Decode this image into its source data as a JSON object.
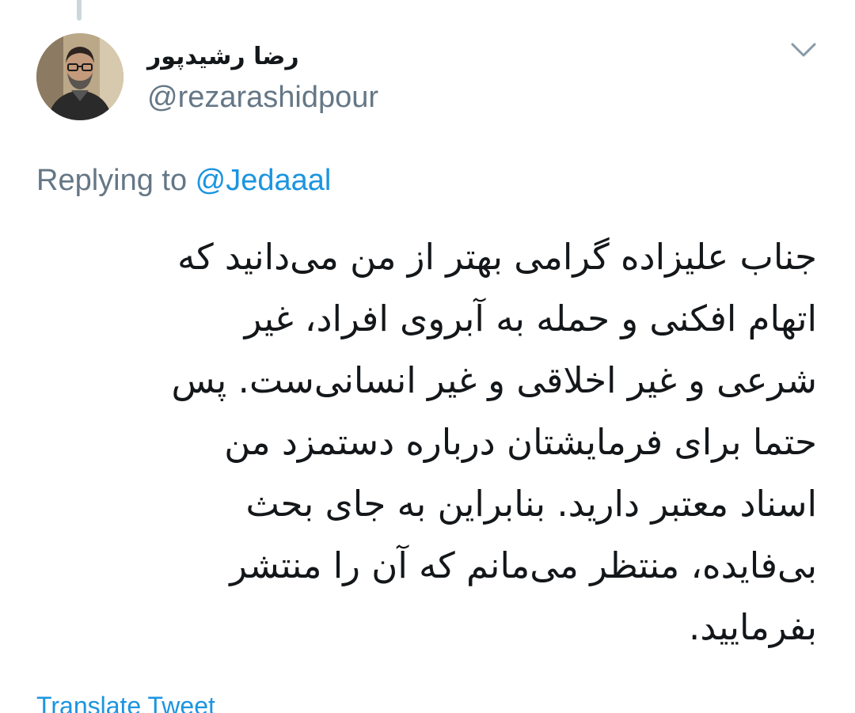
{
  "author": {
    "display_name": "رضا رشیدپور",
    "handle": "@rezarashidpour",
    "avatar_icon": "profile-photo"
  },
  "reply": {
    "prefix": "Replying to ",
    "mention": "@Jedaaal"
  },
  "tweet": {
    "lines": [
      "جناب علیزاده گرامی بهتر از من می‌دانید که",
      "اتهام افکنی و حمله به آبروی افراد، غیر",
      "شرعی و غیر اخلاقی و غیر انسانی‌ست. پس",
      "حتما برای فرمایشتان درباره دستمزد من",
      "اسناد معتبر دارید. بنابراین به جای بحث",
      "بی‌فایده، منتظر می‌مانم که آن را منتشر",
      "بفرمایید."
    ]
  },
  "actions": {
    "translate_label": "Translate Tweet",
    "menu_icon": "chevron-down-icon"
  },
  "colors": {
    "primary_text": "#14171a",
    "secondary_text": "#657786",
    "link": "#1b95e0",
    "thread_line": "#ccd6dd"
  }
}
